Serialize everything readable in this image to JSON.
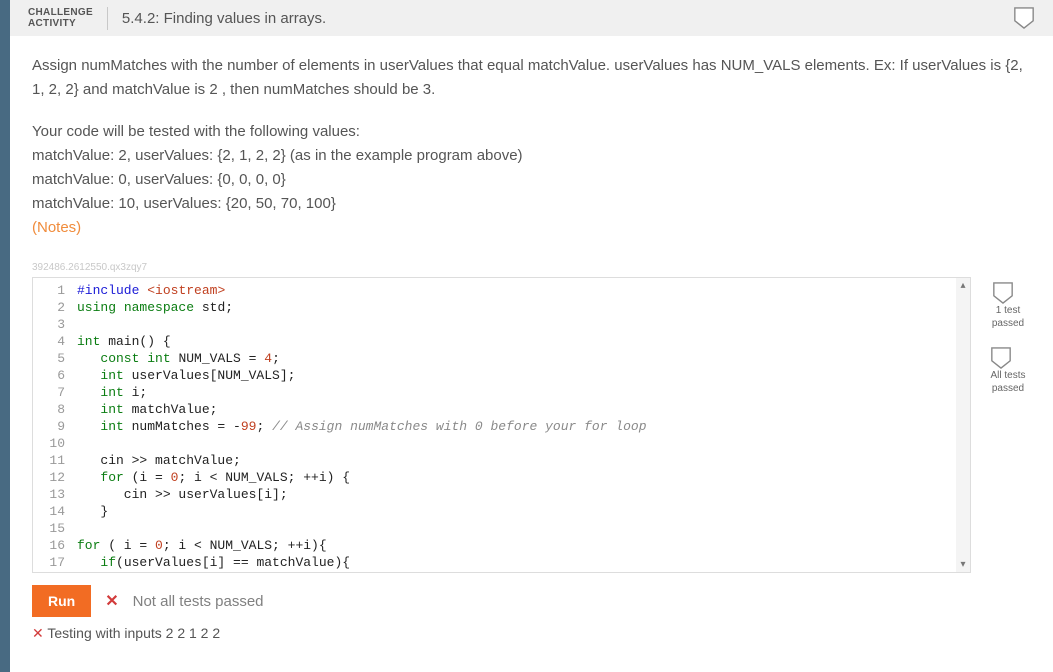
{
  "header": {
    "tag_line1": "CHALLENGE",
    "tag_line2": "ACTIVITY",
    "title": "5.4.2: Finding values in arrays."
  },
  "prompt": {
    "p1": "Assign numMatches with the number of elements in userValues that equal matchValue. userValues has NUM_VALS elements. Ex: If userValues is {2, 1, 2, 2} and matchValue is 2 , then numMatches should be 3.",
    "p2a": "Your code will be tested with the following values:",
    "p2b": "matchValue: 2, userValues: {2, 1, 2, 2} (as in the example program above)",
    "p2c": "matchValue: 0, userValues: {0, 0, 0, 0}",
    "p2d": "matchValue: 10, userValues: {20, 50, 70, 100}",
    "notes": "(Notes)"
  },
  "hash": "392486.2612550.qx3zqy7",
  "code": {
    "lines": [
      {
        "n": 1,
        "h": "<span class=\"pp\">#include</span> <span class=\"inc\">&lt;iostream&gt;</span>"
      },
      {
        "n": 2,
        "h": "<span class=\"kw\">using</span> <span class=\"kw\">namespace</span> std;"
      },
      {
        "n": 3,
        "h": ""
      },
      {
        "n": 4,
        "h": "<span class=\"ty\">int</span> main() {"
      },
      {
        "n": 5,
        "h": "   <span class=\"kw\">const</span> <span class=\"ty\">int</span> NUM_VALS = <span class=\"lit\">4</span>;"
      },
      {
        "n": 6,
        "h": "   <span class=\"ty\">int</span> userValues[NUM_VALS];"
      },
      {
        "n": 7,
        "h": "   <span class=\"ty\">int</span> i;"
      },
      {
        "n": 8,
        "h": "   <span class=\"ty\">int</span> matchValue;"
      },
      {
        "n": 9,
        "h": "   <span class=\"ty\">int</span> numMatches = -<span class=\"lit\">99</span>; <span class=\"cm\">// Assign numMatches with 0 before your for loop</span>"
      },
      {
        "n": 10,
        "h": ""
      },
      {
        "n": 11,
        "h": "   cin &gt;&gt; matchValue;"
      },
      {
        "n": 12,
        "h": "   <span class=\"kw\">for</span> (i = <span class=\"lit\">0</span>; i &lt; NUM_VALS; ++i) {"
      },
      {
        "n": 13,
        "h": "      cin &gt;&gt; userValues[i];"
      },
      {
        "n": 14,
        "h": "   }"
      },
      {
        "n": 15,
        "h": ""
      },
      {
        "n": 16,
        "h": "<span class=\"kw\">for</span> ( i = <span class=\"lit\">0</span>; i &lt; NUM_VALS; ++i){"
      },
      {
        "n": 17,
        "h": "   <span class=\"kw\">if</span>(userValues[i] == matchValue){"
      }
    ]
  },
  "status": {
    "b1": "1 test\npassed",
    "b2": "All tests\npassed"
  },
  "footer": {
    "run": "Run",
    "fail_icon": "✕",
    "fail_text": "Not all tests passed"
  },
  "truncated_peek_prefix": "✕",
  "truncated_peek": "  Testing with inputs 2 2 1 2 2"
}
